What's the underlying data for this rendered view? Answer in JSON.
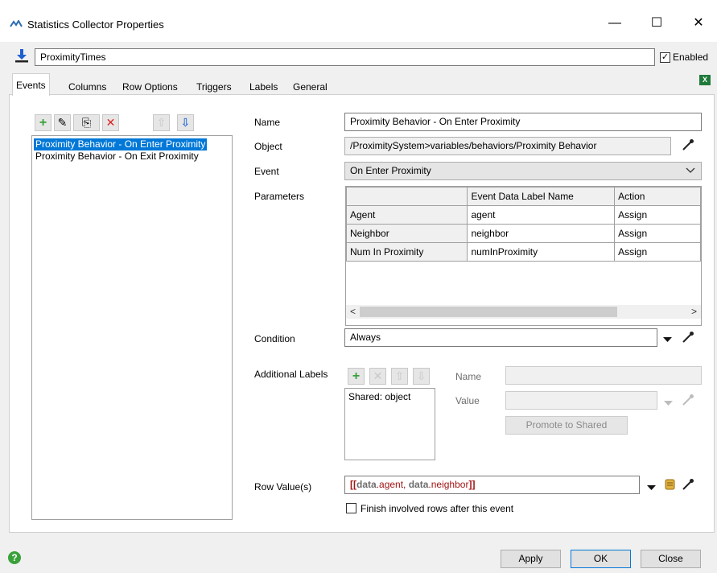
{
  "window": {
    "title": "Statistics Collector Properties",
    "minimize": "—",
    "maximize": "☐",
    "close": "✕"
  },
  "collector": {
    "name": "ProximityTimes",
    "enabled_label": "Enabled",
    "enabled_check": "✓"
  },
  "tabs": [
    {
      "label": "Events"
    },
    {
      "label": "Columns"
    },
    {
      "label": "Row Options"
    },
    {
      "label": "Triggers"
    },
    {
      "label": "Labels"
    },
    {
      "label": "General"
    }
  ],
  "toolbar": {
    "add": "+",
    "sample": "✎",
    "copy": "⎘",
    "delete": "✕",
    "up": "⇧",
    "down": "⇩"
  },
  "events": [
    {
      "label": "Proximity Behavior - On Enter Proximity"
    },
    {
      "label": "Proximity Behavior - On Exit Proximity"
    }
  ],
  "form": {
    "name_label": "Name",
    "name_value": "Proximity Behavior - On Enter Proximity",
    "object_label": "Object",
    "object_value": "/ProximitySystem>variables/behaviors/Proximity Behavior",
    "event_label": "Event",
    "event_value": "On Enter Proximity",
    "parameters_label": "Parameters",
    "condition_label": "Condition",
    "condition_value": "Always",
    "additional_labels_label": "Additional Labels",
    "label_name_label": "Name",
    "label_value_label": "Value",
    "promote_label": "Promote to Shared",
    "row_values_label": "Row Value(s)",
    "row_value_open": "[[",
    "row_value_data1": "data",
    "row_value_mid1": ".agent, ",
    "row_value_data2": "data",
    "row_value_mid2": ".neighbor",
    "row_value_close": "]]",
    "finish_label": "Finish involved rows after this event"
  },
  "parameters": {
    "headers": [
      "",
      "Event Data Label Name",
      "Action"
    ],
    "rows": [
      [
        "Agent",
        "agent",
        "Assign"
      ],
      [
        "Neighbor",
        "neighbor",
        "Assign"
      ],
      [
        "Num In Proximity",
        "numInProximity",
        "Assign"
      ]
    ]
  },
  "additional_labels": [
    {
      "label": "Shared: object"
    }
  ],
  "scroll": {
    "left": "<",
    "right": ">"
  },
  "footer": {
    "help": "?",
    "apply": "Apply",
    "ok": "OK",
    "close": "Close"
  },
  "colors": {
    "accent": "#0078d7",
    "selection": "#0078d7",
    "add_green": "#3aa13a",
    "delete_red": "#e02020",
    "arrow_blue": "#2f6fd6",
    "keyword_red": "#a31515",
    "keyword_gray": "#6d6d6d"
  }
}
